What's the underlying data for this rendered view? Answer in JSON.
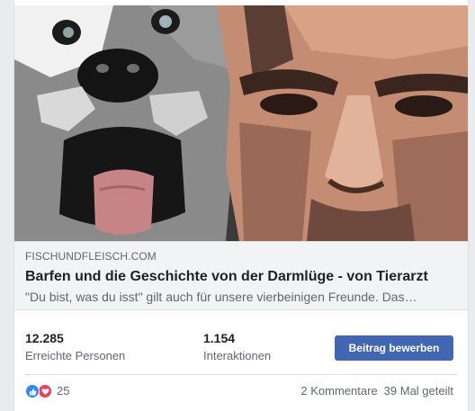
{
  "post": {
    "link": {
      "image_alt": "Husky dog and man face, posterized illustration",
      "domain": "FISCHUNDFLEISCH.COM",
      "title": "Barfen und die Geschichte von der Darmlüge - von Tierarzt",
      "description": "\"Du bist, was du isst\" gilt auch für unsere vierbeinigen Freunde. Das…"
    },
    "insights": {
      "reach_value": "12.285",
      "reach_label": "Erreichte Personen",
      "interactions_value": "1.154",
      "interactions_label": "Interaktionen",
      "boost_label": "Beitrag bewerben"
    },
    "engagement": {
      "reaction_icons": [
        "like-icon",
        "love-icon"
      ],
      "reactions_count": "25",
      "comments": "2 Kommentare",
      "shares": "39 Mal geteilt"
    }
  },
  "colors": {
    "accent": "#4267b2",
    "like": "#2d88ff",
    "love": "#f33e58",
    "text_primary": "#1d2129",
    "text_secondary": "#606770"
  }
}
